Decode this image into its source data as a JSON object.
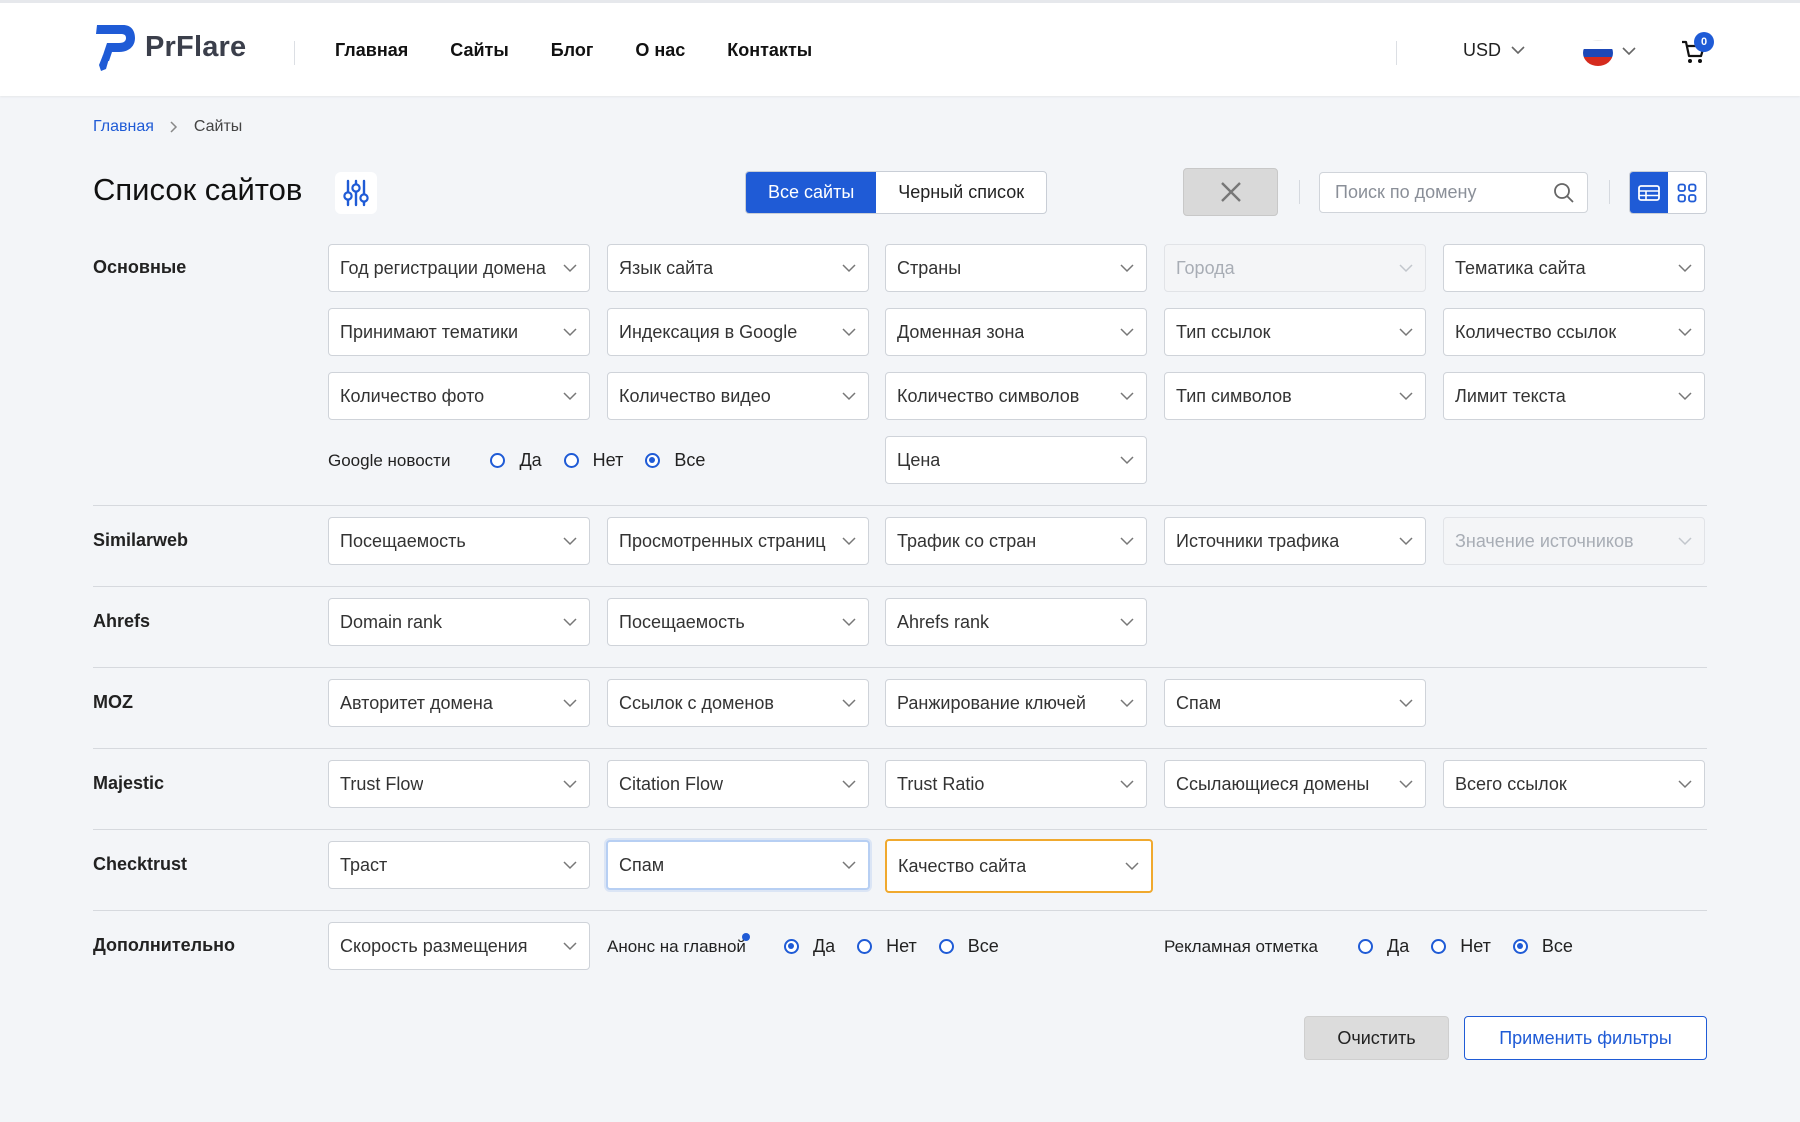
{
  "header": {
    "logo_text": "PrFlare",
    "nav": [
      "Главная",
      "Сайты",
      "Блог",
      "О нас",
      "Контакты"
    ],
    "currency": "USD",
    "language_flag": "flag-ru-icon",
    "cart_count": "0"
  },
  "breadcrumb": {
    "home": "Главная",
    "current": "Сайты"
  },
  "title": "Список сайтов",
  "tabs": {
    "all": "Все сайты",
    "blacklist": "Черный список"
  },
  "search": {
    "placeholder": "Поиск по домену",
    "value": ""
  },
  "colors": {
    "accent": "#1f5bd6",
    "hover_outline": "#f0a92e"
  },
  "sections": {
    "main": {
      "label": "Основные",
      "row1": [
        "Год регистрации домена",
        "Язык сайта",
        "Страны",
        "Города",
        "Тематика сайта"
      ],
      "row2": [
        "Принимают тематики",
        "Индексация в Google",
        "Доменная зона",
        "Тип ссылок",
        "Количество ссылок"
      ],
      "row3": [
        "Количество фото",
        "Количество видео",
        "Количество символов",
        "Тип символов",
        "Лимит текста"
      ],
      "google_news": {
        "label": "Google новости",
        "options": [
          "Да",
          "Нет",
          "Все"
        ],
        "selected": "Все"
      },
      "price": "Цена"
    },
    "similarweb": {
      "label": "Similarweb",
      "items": [
        "Посещаемость",
        "Просмотренных страниц",
        "Трафик со стран",
        "Источники трафика",
        "Значение источников"
      ]
    },
    "ahrefs": {
      "label": "Ahrefs",
      "items": [
        "Domain rank",
        "Посещаемость",
        "Ahrefs rank"
      ]
    },
    "moz": {
      "label": "MOZ",
      "items": [
        "Авторитет домена",
        "Ссылок с доменов",
        "Ранжирование ключей",
        "Спам"
      ]
    },
    "majestic": {
      "label": "Majestic",
      "items": [
        "Trust Flow",
        "Citation Flow",
        "Trust Ratio",
        "Ссылающиеся домены",
        "Всего ссылок"
      ]
    },
    "checktrust": {
      "label": "Checktrust",
      "items": [
        "Траст",
        "Спам",
        "Качество сайта"
      ]
    },
    "extra": {
      "label": "Дополнительно",
      "speed": "Скорость размещения",
      "announce": {
        "label": "Анонс на главной",
        "options": [
          "Да",
          "Нет",
          "Все"
        ],
        "selected": "Да"
      },
      "ad_mark": {
        "label": "Рекламная отметка",
        "options": [
          "Да",
          "Нет",
          "Все"
        ],
        "selected": "Все"
      }
    }
  },
  "buttons": {
    "clear": "Очистить",
    "apply": "Применить фильтры"
  }
}
